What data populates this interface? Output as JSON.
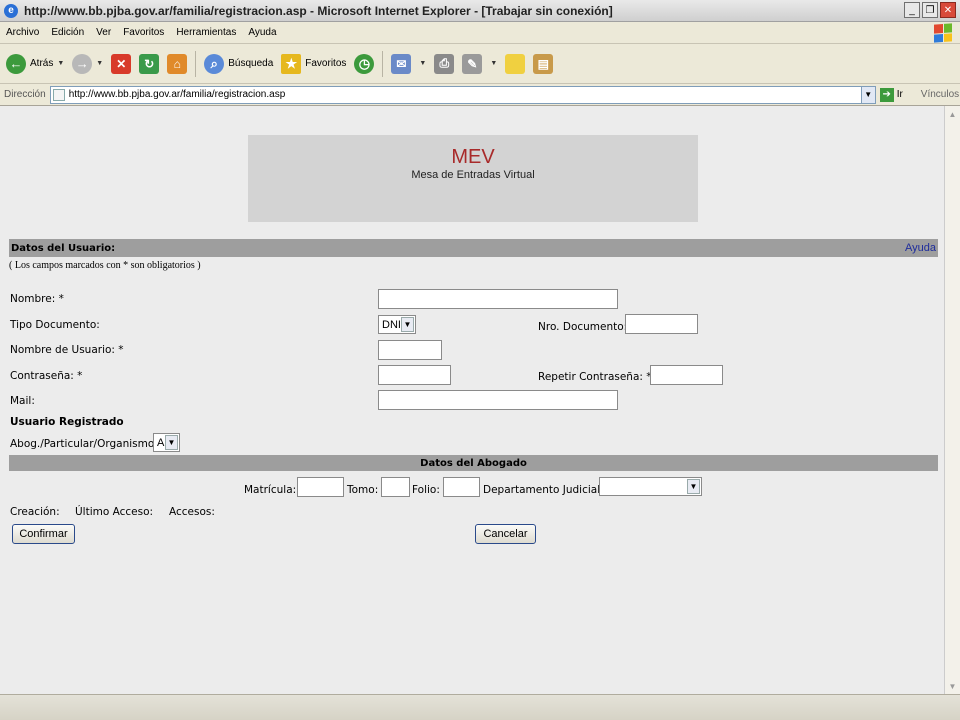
{
  "window": {
    "title": "http://www.bb.pjba.gov.ar/familia/registracion.asp - Microsoft Internet Explorer - [Trabajar sin conexión]",
    "buttons": [
      "_",
      "❐",
      "✕"
    ]
  },
  "menu": [
    "Archivo",
    "Edición",
    "Ver",
    "Favoritos",
    "Herramientas",
    "Ayuda"
  ],
  "toolbar": {
    "back_label": "Atrás",
    "search_label": "Búsqueda",
    "favorites_label": "Favoritos"
  },
  "address": {
    "label": "Dirección",
    "url": "http://www.bb.pjba.gov.ar/familia/registracion.asp",
    "go_label": "Ir",
    "links_label": "Vínculos"
  },
  "page": {
    "banner_title": "MEV",
    "banner_subtitle": "Mesa de Entradas Virtual",
    "section_user": "Datos del Usuario:",
    "help_link": "Ayuda",
    "required_note": "( Los campos marcados con * son obligatorios )",
    "fields": {
      "nombre": "Nombre: *",
      "tipo_documento": "Tipo Documento:",
      "tipo_documento_value": "DNI",
      "nro_documento": "Nro. Documento:",
      "nombre_usuario": "Nombre de Usuario: *",
      "contrasena": "Contraseña: *",
      "repetir_contrasena": "Repetir Contraseña: *",
      "mail": "Mail:",
      "usuario_registrado": "Usuario Registrado",
      "abog": "Abog./Particular/Organismo:",
      "abog_value": "A"
    },
    "section_lawyer": "Datos del Abogado",
    "lawyer_fields": {
      "matricula": "Matrícula:",
      "tomo": "Tomo:",
      "folio": "Folio:",
      "departamento": "Departamento Judicial:"
    },
    "info": {
      "creacion": "Creación:",
      "ultimo_acceso": "Último Acceso:",
      "accesos": "Accesos:"
    },
    "confirm_button": "Confirmar",
    "cancel_button": "Cancelar"
  },
  "colors": {
    "banner_title": "#a82a2a",
    "section_bar": "#9e9e9e",
    "content_bg": "#ececec",
    "help_link": "#1f2d9c"
  }
}
